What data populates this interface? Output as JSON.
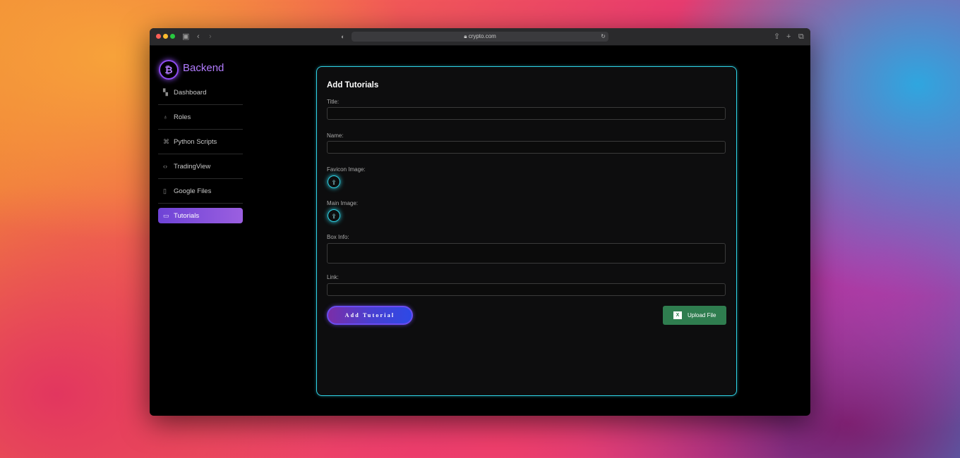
{
  "browser": {
    "url": "crypto.com",
    "traffic_light_colors": [
      "#ff5f57",
      "#febc2e",
      "#28c840"
    ]
  },
  "sidebar": {
    "brand_symbol": "₿",
    "brand_name": "Backend",
    "items": [
      {
        "label": "Dashboard",
        "icon": "grid-icon"
      },
      {
        "label": "Roles",
        "icon": "users-icon"
      },
      {
        "label": "Python Scripts",
        "icon": "python-icon"
      },
      {
        "label": "TradingView",
        "icon": "code-icon"
      },
      {
        "label": "Google Files",
        "icon": "file-icon"
      },
      {
        "label": "Tutorials",
        "icon": "video-icon",
        "active": true
      }
    ]
  },
  "form": {
    "title": "Add Tutorials",
    "title_label": "Title:",
    "name_label": "Name:",
    "favicon_label": "Favicon Image:",
    "main_image_label": "Main Image:",
    "box_info_label": "Box Info:",
    "link_label": "Link:",
    "title_value": "",
    "name_value": "",
    "box_info_value": "",
    "link_value": "",
    "add_button": "Add Tutorial",
    "upload_button": "Upload File",
    "upload_button_color": "#2f7d4f",
    "accent_color": "#2fd3e6"
  }
}
